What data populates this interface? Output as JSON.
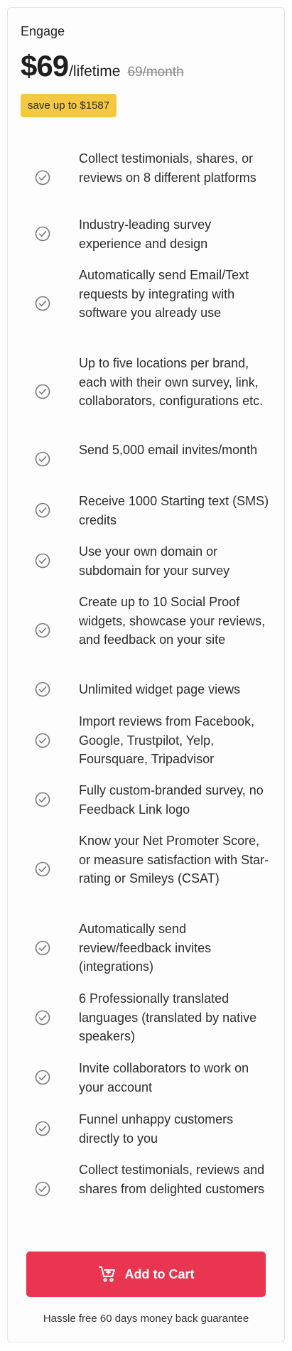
{
  "plan": {
    "name": "Engage",
    "price": "$69",
    "period": "/lifetime",
    "old_price": "69/month",
    "save_badge": "save up to $1587"
  },
  "features": [
    "Collect testimonials, shares, or reviews on 8 different platforms",
    "Industry-leading survey experience and design",
    "Automatically send Email/Text requests by integrating with software you already use",
    "Up to five locations per brand, each with their own survey, link, collaborators, configurations etc.",
    "Send 5,000 email invites/month",
    "Receive 1000 Starting text (SMS) credits",
    "Use your own domain or subdomain for your survey",
    "Create up to 10 Social Proof widgets, showcase your reviews, and feedback on your site",
    "Unlimited widget page views",
    "Import reviews from Facebook, Google, Trustpilot, Yelp, Foursquare, Tripadvisor",
    "Fully custom-branded survey, no Feedback Link logo",
    "Know your Net Promoter Score, or measure satisfaction with Star-rating or Smileys (CSAT)",
    "Automatically send review/feedback invites (integrations)",
    "6 Professionally translated languages (translated by native speakers)",
    "Invite collaborators to work on your account",
    "Funnel unhappy customers directly to you",
    "Collect testimonials, reviews and shares from delighted customers"
  ],
  "icons": {
    "feature_check": "check-circle-icon",
    "cart": "cart-plus-icon"
  },
  "cta": {
    "add_to_cart": "Add to Cart"
  },
  "guarantee": "Hassle free 60 days money back guarantee",
  "colors": {
    "accent": "#ea3550",
    "badge": "#f5c842",
    "check": "#7a7a7a"
  }
}
